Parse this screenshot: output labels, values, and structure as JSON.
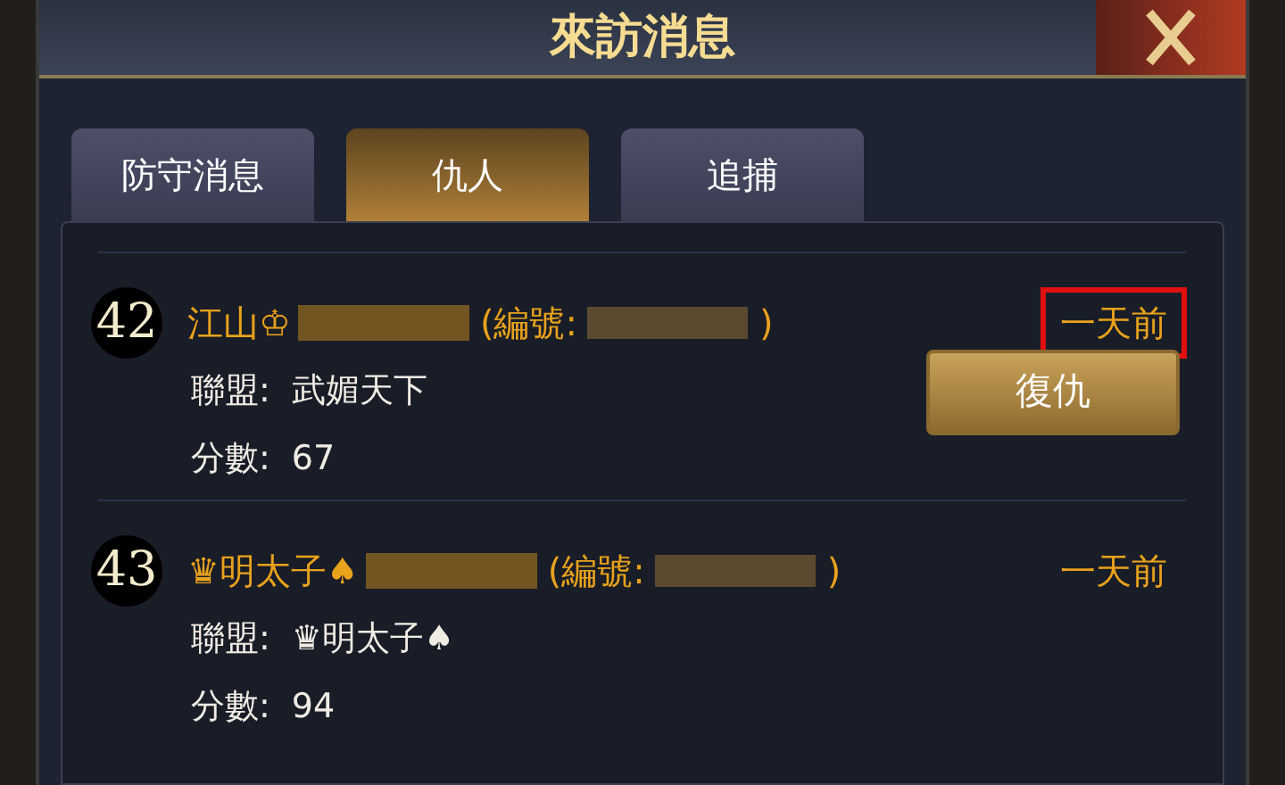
{
  "title": "來訪消息",
  "tabs": [
    {
      "label": "防守消息",
      "selected": false
    },
    {
      "label": "仇人",
      "selected": true
    },
    {
      "label": "追捕",
      "selected": false
    }
  ],
  "entries": [
    {
      "rank": "42",
      "name": "江山♔",
      "id_label": "(編號:",
      "id_close": ")",
      "time": "一天前",
      "time_highlighted": true,
      "alliance_label": "聯盟:",
      "alliance": "武媚天下",
      "score_label": "分數:",
      "score": "67",
      "action": "復仇"
    },
    {
      "rank": "43",
      "name": "♛明太子♠",
      "id_label": "(編號:",
      "id_close": ")",
      "time": "一天前",
      "time_highlighted": false,
      "alliance_label": "聯盟:",
      "alliance": "♛明太子♠",
      "score_label": "分數:",
      "score": "94"
    }
  ]
}
